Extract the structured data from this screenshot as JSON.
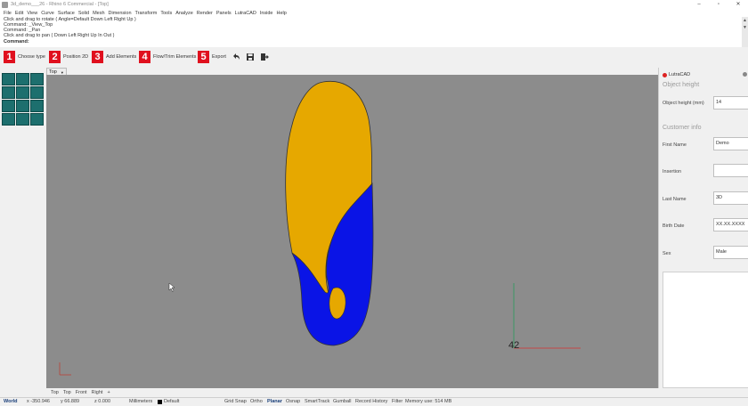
{
  "window": {
    "title": "3d_demo___26 - Rhino 6 Commercial - [Top]",
    "controls": [
      "–",
      "▫",
      "✕"
    ]
  },
  "menu": [
    "File",
    "Edit",
    "View",
    "Curve",
    "Surface",
    "Solid",
    "Mesh",
    "Dimension",
    "Transform",
    "Tools",
    "Analyze",
    "Render",
    "Panels",
    "LutraCAD",
    "Inside",
    "Help"
  ],
  "command_history": [
    "Click and drag to rotate ( Angle=Default  Down  Left  Right  Up )",
    "Command: _View_Top",
    "Command: _Pan",
    "Click and drag to pan ( Down  Left  Right  Up  In  Out )",
    "Command:"
  ],
  "steps": [
    {
      "num": "1",
      "label": "Choose type"
    },
    {
      "num": "2",
      "label": "Position 2D"
    },
    {
      "num": "3",
      "label": "Add Elements"
    },
    {
      "num": "4",
      "label": "Flow/Trim Elements"
    },
    {
      "num": "5",
      "label": "Export"
    }
  ],
  "viewport": {
    "name": "Top",
    "axis_label": "42",
    "colors": {
      "upper": "#e6a800",
      "lower": "#0a14e6",
      "background": "#8c8c8c"
    }
  },
  "viewport_tabs": [
    "Top",
    "Top",
    "Front",
    "Right",
    "+"
  ],
  "panel": {
    "header": "LutraCAD",
    "section_height": "Object height",
    "object_height_label": "Object height (mm)",
    "object_height_value": "14",
    "section_customer": "Customer info",
    "fields": [
      {
        "label": "First Name",
        "value": "Demo"
      },
      {
        "label": "Insertion",
        "value": ""
      },
      {
        "label": "Last Name",
        "value": "3D"
      },
      {
        "label": "Birth Date",
        "value": "XX.XX.XXXX"
      },
      {
        "label": "Sex",
        "value": "Male"
      }
    ]
  },
  "status": {
    "world": "World",
    "x": "x -350.946",
    "y": "y 66.889",
    "z": "z 0.000",
    "units": "Millimeters",
    "layer": "Default",
    "grid_snap": "Grid Snap",
    "ortho": "Ortho",
    "planar": "Planar",
    "osnap": "Osnap",
    "smarttrack": "SmartTrack",
    "gumball": "Gumball",
    "record_history": "Record History",
    "filter": "Filter",
    "memory": "Memory use: 514 MB"
  }
}
